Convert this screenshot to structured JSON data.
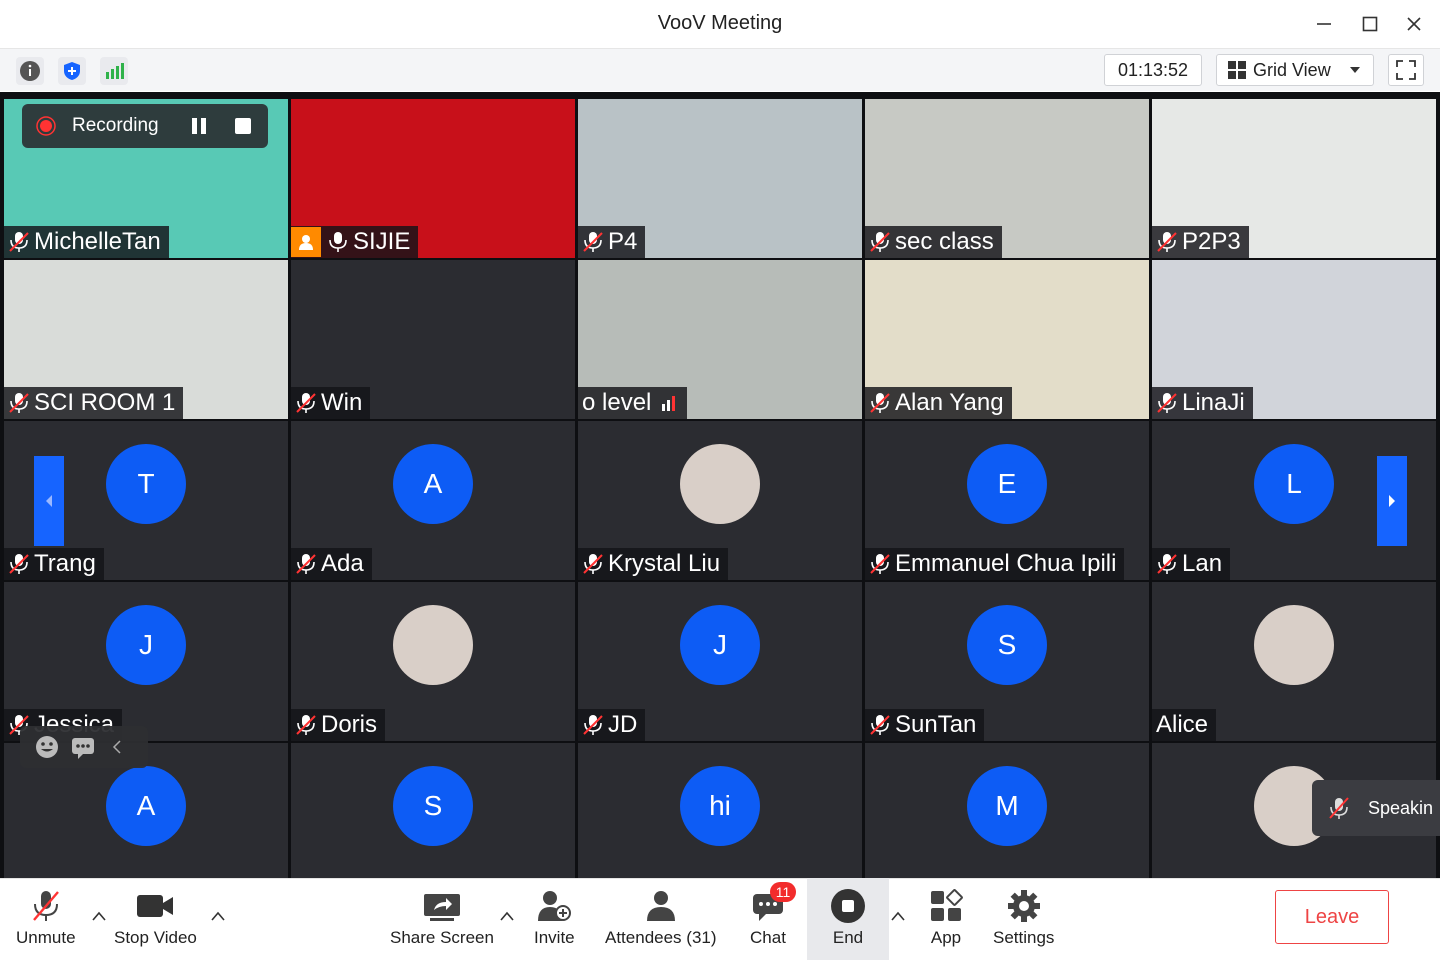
{
  "window": {
    "title": "VooV Meeting"
  },
  "toolbar": {
    "timer": "01:13:52",
    "view_label": "Grid View"
  },
  "recording": {
    "label": "Recording"
  },
  "tiles": [
    {
      "name": "MichelleTan",
      "kind": "video",
      "bg": "#58c9b5"
    },
    {
      "name": "SIJIE",
      "kind": "video",
      "bg": "#c8101a",
      "host": true
    },
    {
      "name": "P4",
      "kind": "video",
      "bg": "#b9c2c6"
    },
    {
      "name": "sec class",
      "kind": "video",
      "bg": "#c7c9c4"
    },
    {
      "name": "P2P3",
      "kind": "video",
      "bg": "#e6e8e6"
    },
    {
      "name": "SCI ROOM 1",
      "kind": "video",
      "bg": "#d9dcd9"
    },
    {
      "name": "Win",
      "kind": "video",
      "bg": "#2b2c31"
    },
    {
      "name": "o level",
      "kind": "video",
      "bg": "#b7bcb8",
      "signal": true
    },
    {
      "name": "Alan Yang",
      "kind": "video",
      "bg": "#e3ddc9"
    },
    {
      "name": "LinaJi",
      "kind": "video",
      "bg": "#d1d4da"
    },
    {
      "name": "Trang",
      "kind": "avatar",
      "initial": "T"
    },
    {
      "name": "Ada",
      "kind": "avatar",
      "initial": "A"
    },
    {
      "name": "Krystal Liu",
      "kind": "photo"
    },
    {
      "name": "Emmanuel Chua Ipili",
      "kind": "avatar",
      "initial": "E"
    },
    {
      "name": "Lan",
      "kind": "avatar",
      "initial": "L"
    },
    {
      "name": "Jessica",
      "kind": "avatar",
      "initial": "J"
    },
    {
      "name": "Doris",
      "kind": "photo"
    },
    {
      "name": "JD",
      "kind": "avatar",
      "initial": "J"
    },
    {
      "name": "SunTan",
      "kind": "avatar",
      "initial": "S"
    },
    {
      "name": "Alice",
      "kind": "photo",
      "nomic": true
    },
    {
      "name": "",
      "kind": "avatar",
      "initial": "A"
    },
    {
      "name": "",
      "kind": "avatar",
      "initial": "S"
    },
    {
      "name": "",
      "kind": "avatar",
      "initial": "hi"
    },
    {
      "name": "",
      "kind": "avatar",
      "initial": "M"
    },
    {
      "name": "",
      "kind": "photo"
    }
  ],
  "speaking": {
    "label": "Speakin"
  },
  "bottombar": {
    "unmute": "Unmute",
    "stop_video": "Stop Video",
    "share_screen": "Share Screen",
    "invite": "Invite",
    "attendees": "Attendees (31)",
    "chat": "Chat",
    "chat_badge": "11",
    "end": "End",
    "app": "App",
    "settings": "Settings",
    "leave": "Leave"
  },
  "colors": {
    "accent": "#0d5cf5",
    "leave": "#ee4444",
    "badge": "#f22c2c"
  }
}
